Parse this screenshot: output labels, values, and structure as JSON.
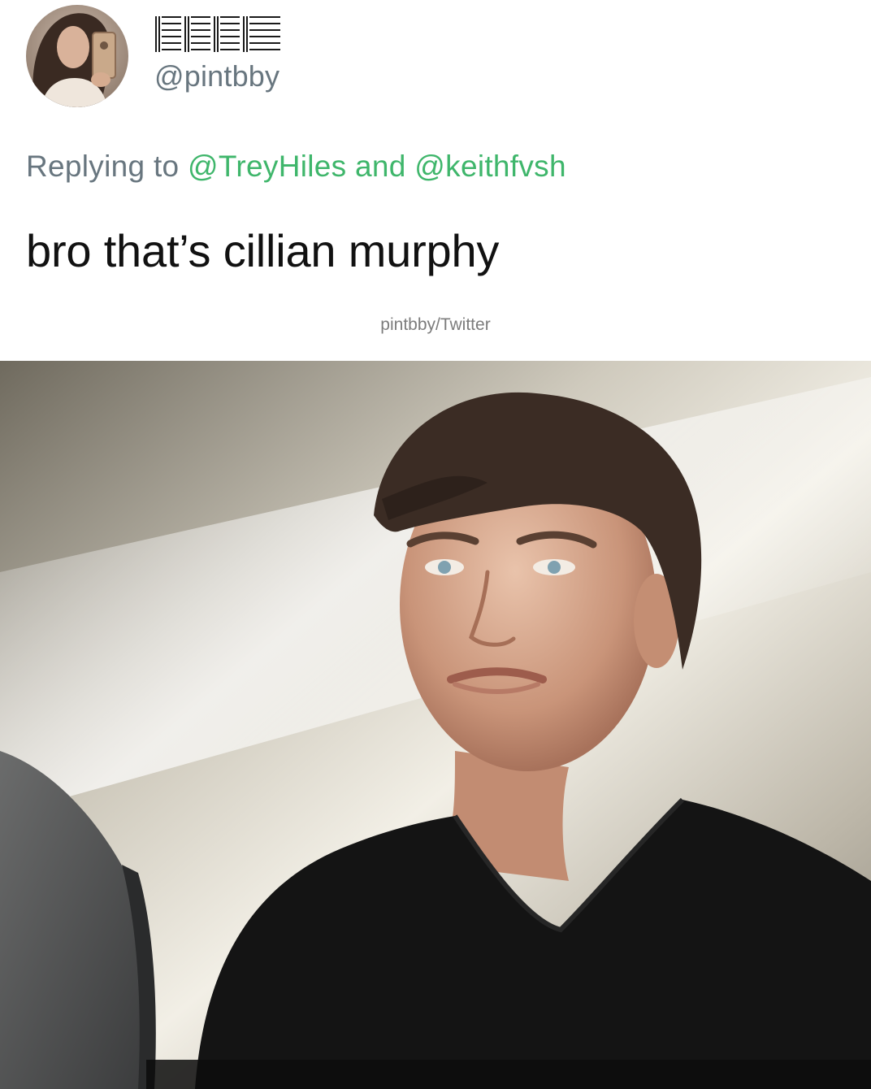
{
  "tweet": {
    "user": {
      "handle": "@pintbby",
      "avatar_icon": "avatar-photo"
    },
    "reply": {
      "prefix": "Replying to",
      "mention_1": "@TreyHiles",
      "conjunction": "and",
      "mention_2": "@keithfvsh"
    },
    "text": "bro that’s cillian murphy"
  },
  "credit": "pintbby/Twitter",
  "colors": {
    "mention": "#3fb66b",
    "muted": "#68767f",
    "text": "#111111"
  }
}
